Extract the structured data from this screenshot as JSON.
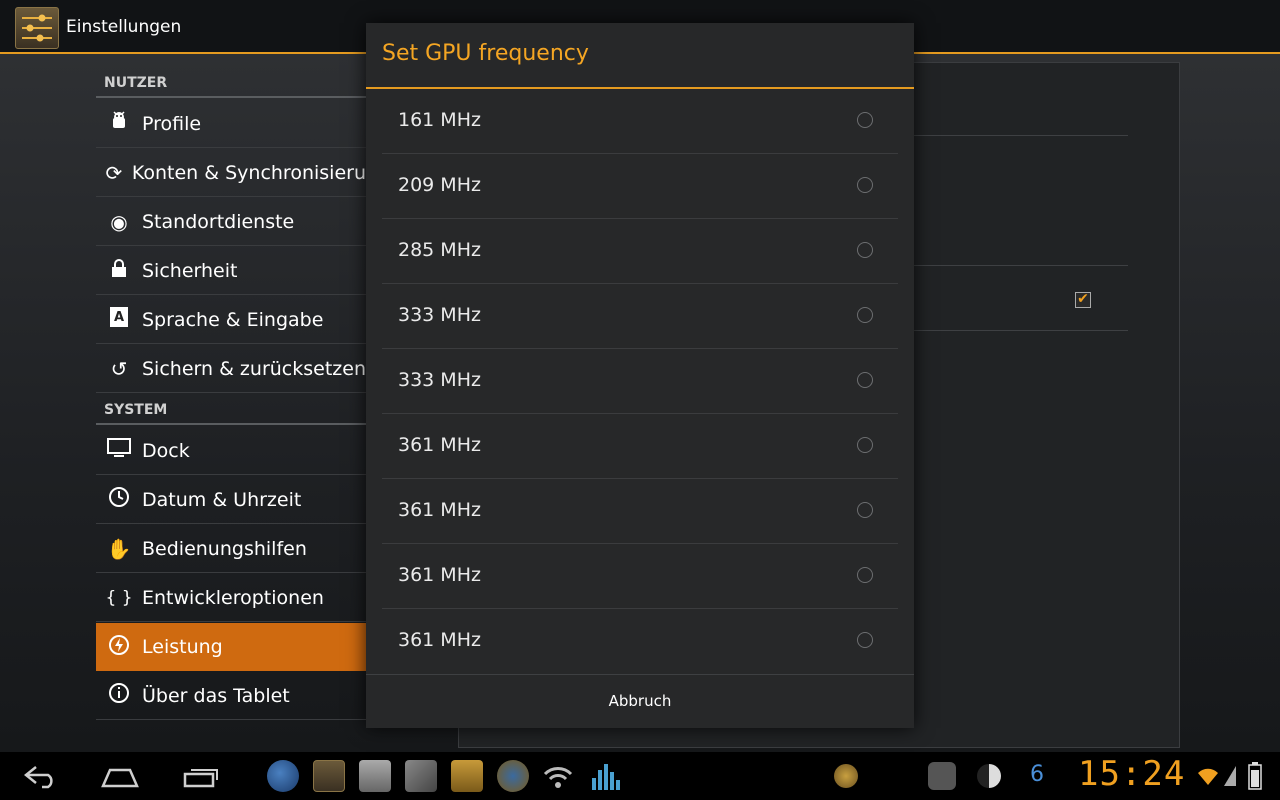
{
  "app": {
    "title": "Einstellungen"
  },
  "sidebar": {
    "section_user": "NUTZER",
    "section_system": "SYSTEM",
    "items": [
      {
        "label": "Profile",
        "icon": "android-icon"
      },
      {
        "label": "Konten & Synchronisieru",
        "icon": "sync-icon"
      },
      {
        "label": "Standortdienste",
        "icon": "location-icon"
      },
      {
        "label": "Sicherheit",
        "icon": "lock-icon"
      },
      {
        "label": "Sprache & Eingabe",
        "icon": "keyboard-a-icon"
      },
      {
        "label": "Sichern & zurücksetzen",
        "icon": "restore-icon"
      },
      {
        "label": "Dock",
        "icon": "monitor-icon"
      },
      {
        "label": "Datum & Uhrzeit",
        "icon": "clock-icon"
      },
      {
        "label": "Bedienungshilfen",
        "icon": "hand-icon"
      },
      {
        "label": "Entwickleroptionen",
        "icon": "braces-icon"
      },
      {
        "label": "Leistung",
        "icon": "performance-icon"
      },
      {
        "label": "Über das Tablet",
        "icon": "info-icon"
      }
    ],
    "active": "Leistung"
  },
  "dialog": {
    "title": "Set GPU frequency",
    "options": [
      {
        "label": "161 MHz"
      },
      {
        "label": "209 MHz"
      },
      {
        "label": "285 MHz"
      },
      {
        "label": "333 MHz"
      },
      {
        "label": "333 MHz"
      },
      {
        "label": "361 MHz"
      },
      {
        "label": "361 MHz"
      },
      {
        "label": "361 MHz"
      },
      {
        "label": "361 MHz"
      }
    ],
    "cancel_label": "Abbruch"
  },
  "statusbar": {
    "time": "15:24",
    "notification_count": "6"
  },
  "colors": {
    "accent": "#e59b20",
    "active_item": "#cf6a10",
    "dialog_bg": "#272829"
  }
}
